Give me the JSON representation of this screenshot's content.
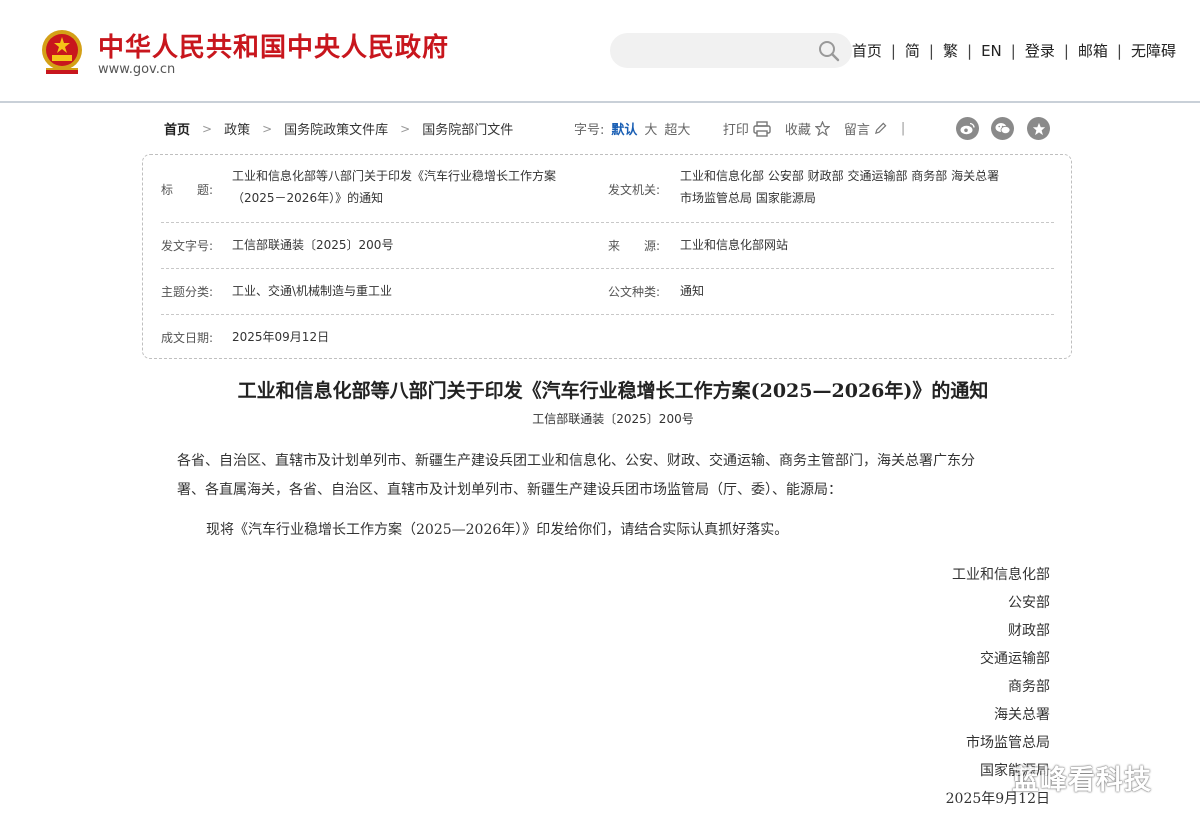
{
  "header": {
    "site_title": "中华人民共和国中央人民政府",
    "site_url": "www.gov.cn",
    "search_placeholder": "",
    "nav": [
      "首页",
      "简",
      "繁",
      "EN",
      "登录",
      "邮箱",
      "无障碍"
    ],
    "nav_separator": "|"
  },
  "breadcrumb": {
    "items": [
      "首页",
      "政策",
      "国务院政策文件库",
      "国务院部门文件"
    ],
    "separator": ">"
  },
  "tools": {
    "font_size_label": "字号:",
    "font_default": "默认",
    "font_large": "大",
    "font_xlarge": "超大",
    "print": "打印",
    "favorite": "收藏",
    "comment": "留言",
    "bar": "|",
    "share_icons": [
      "weibo-icon",
      "wechat-icon",
      "qzone-icon"
    ]
  },
  "info": {
    "title_label": "标　　题:",
    "title_value_line1": "工业和信息化部等八部门关于印发《汽车行业稳增长工作方案",
    "title_value_line2": "（2025－2026年）》的通知",
    "issuer_label": "发文机关:",
    "issuer_value_line1": "工业和信息化部  公安部  财政部  交通运输部  商务部  海关总署",
    "issuer_value_line2": "市场监管总局  国家能源局",
    "docno_label": "发文字号:",
    "docno_value": "工信部联通装〔2025〕200号",
    "source_label": "来　　源:",
    "source_value": "工业和信息化部网站",
    "topic_label": "主题分类:",
    "topic_value": "工业、交通\\机械制造与重工业",
    "type_label": "公文种类:",
    "type_value": "通知",
    "date_label": "成文日期:",
    "date_value": "2025年09月12日"
  },
  "article": {
    "title": "工业和信息化部等八部门关于印发《汽车行业稳增长工作方案(2025—2026年)》的通知",
    "doc_no": "工信部联通装〔2025〕200号",
    "addressee_line1": "各省、自治区、直辖市及计划单列市、新疆生产建设兵团工业和信息化、公安、财政、交通运输、商务主管部门，海关总署广东分",
    "addressee_line2": "署、各直属海关，各省、自治区、直辖市及计划单列市、新疆生产建设兵团市场监管局（厅、委）、能源局：",
    "body": "现将《汽车行业稳增长工作方案（2025—2026年）》印发给你们，请结合实际认真抓好落实。",
    "signatories": [
      "工业和信息化部",
      "公安部",
      "财政部",
      "交通运输部",
      "商务部",
      "海关总署",
      "市场监管总局",
      "国家能源局"
    ],
    "sign_date": "2025年9月12日"
  },
  "watermark": "蓝峰看科技"
}
